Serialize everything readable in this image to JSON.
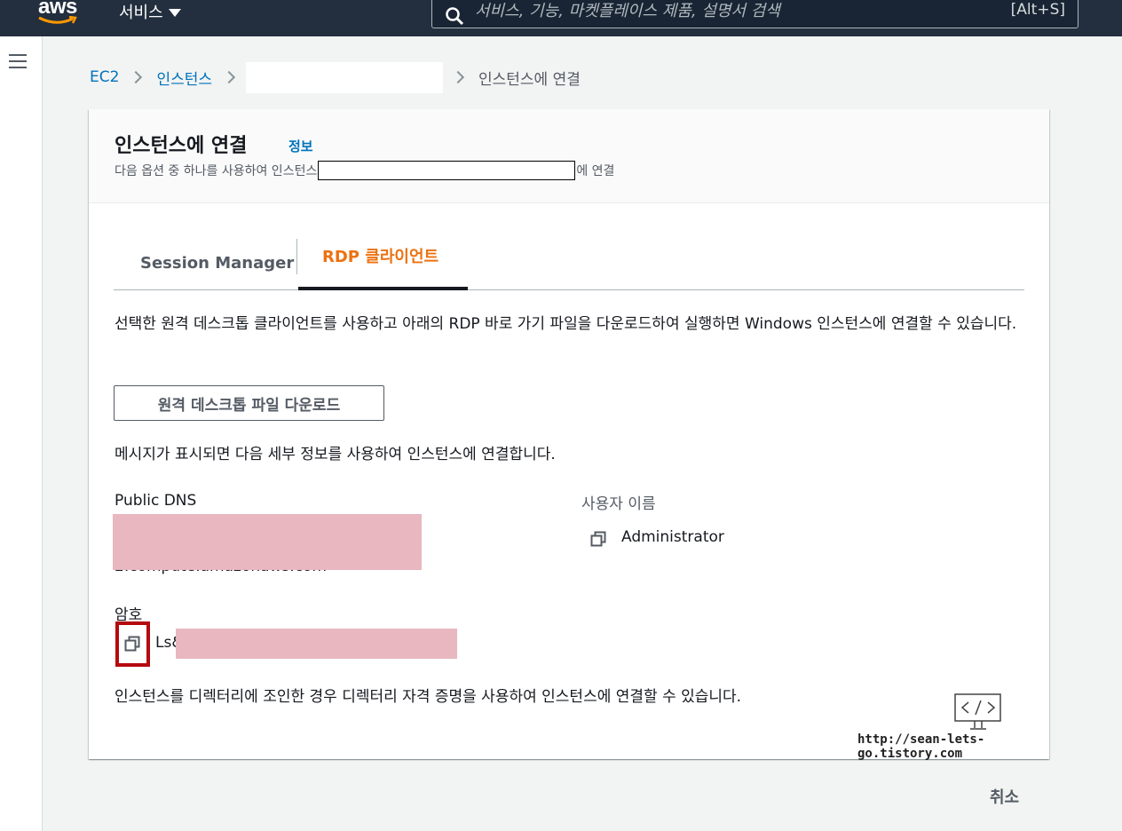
{
  "topnav": {
    "logo": "aws",
    "services_label": "서비스",
    "search_placeholder": "서비스, 기능, 마켓플레이스 제품, 설명서 검색",
    "search_shortcut": "[Alt+S]"
  },
  "breadcrumb": {
    "items": [
      "EC2",
      "인스턴스"
    ],
    "current": "인스턴스에 연결"
  },
  "panel": {
    "title": "인스턴스에 연결",
    "info_link": "정보",
    "desc_prefix": "다음 옵션 중 하나를 사용하여 인스턴스",
    "desc_suffix": "에 연결"
  },
  "tabs": [
    {
      "label": "Session Manager",
      "active": false
    },
    {
      "label": "RDP 클라이언트",
      "active": true
    }
  ],
  "rdp": {
    "intro": "선택한 원격 데스크톱 클라이언트를 사용하고 아래의 RDP 바로 가기 파일을 다운로드하여 실행하면 Windows 인스턴스에 연결할 수 있습니다.",
    "download_button": "원격 데스크톱 파일 다운로드",
    "prompt_text": "메시지가 표시되면 다음 세부 정보를 사용하여 인스턴스에 연결합니다.",
    "public_dns_label": "Public DNS",
    "public_dns_value_visible": "2.compute.amazonaws.com",
    "username_label": "사용자 이름",
    "username_value": "Administrator",
    "password_label": "암호",
    "password_value_visible": "Ls&",
    "directory_note": "인스턴스를 디렉터리에 조인한 경우 디렉터리 자격 증명을 사용하여 인스턴스에 연결할 수 있습니다."
  },
  "watermark": {
    "icon": "code-monitor-icon",
    "url": "http://sean-lets-go.tistory.com"
  },
  "footer": {
    "cancel_label": "취소"
  },
  "colors": {
    "nav_bg": "#232f3e",
    "link": "#0073bb",
    "active_tab": "#ec7211",
    "highlight_box": "#b4090e",
    "redaction": "#e8b7bf"
  }
}
